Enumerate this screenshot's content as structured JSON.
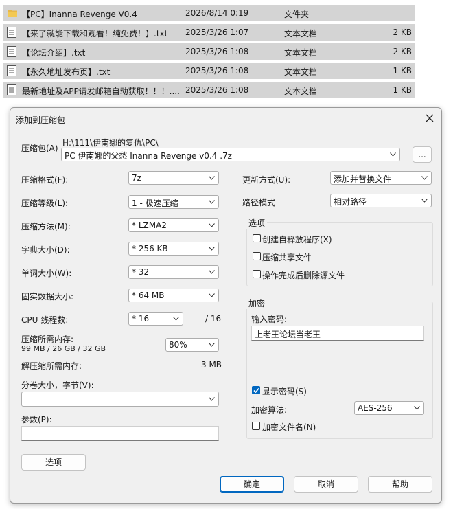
{
  "files": [
    {
      "icon": "folder-icon",
      "name": "【PC】Inanna Revenge V0.4",
      "date": "2026/8/14 0:19",
      "type": "文件夹",
      "size": ""
    },
    {
      "icon": "text-file-icon",
      "name": "【来了就能下载和观看！纯免费！】.txt",
      "date": "2025/3/26 1:07",
      "type": "文本文档",
      "size": "2 KB"
    },
    {
      "icon": "text-file-icon",
      "name": "【论坛介绍】.txt",
      "date": "2025/3/26 1:08",
      "type": "文本文档",
      "size": "2 KB"
    },
    {
      "icon": "text-file-icon",
      "name": "【永久地址发布页】.txt",
      "date": "2025/3/26 1:08",
      "type": "文本文档",
      "size": "1 KB"
    },
    {
      "icon": "text-file-icon",
      "name": "最新地址及APP请发邮箱自动获取！！！....",
      "date": "2025/3/26 1:08",
      "type": "文本文档",
      "size": "1 KB"
    }
  ],
  "dialog": {
    "title": "添加到压缩包",
    "archive_label": "压缩包(A)",
    "archive_path": "H:\\111\\伊南娜的复仇\\PC\\",
    "archive_name": "PC 伊南娜的父愁 Inanna Revenge v0.4 .7z",
    "browse_label": "...",
    "left": [
      {
        "label": "压缩格式(F):",
        "value": "7z"
      },
      {
        "label": "压缩等级(L):",
        "value": "1 - 极速压缩"
      },
      {
        "label": "压缩方法(M):",
        "value": "* LZMA2"
      },
      {
        "label": "字典大小(D):",
        "value": "* 256 KB"
      },
      {
        "label": "单词大小(W):",
        "value": "* 32"
      },
      {
        "label": "固实数据大小:",
        "value": "* 64 MB"
      }
    ],
    "cpu_label": "CPU 线程数:",
    "cpu_value": "* 16",
    "cpu_total": "/ 16",
    "mem_label": "压缩所需内存:",
    "mem_detail": "99 MB / 26 GB / 32 GB",
    "mem_percent": "80%",
    "decomp_label": "解压缩所需内存:",
    "decomp_value": "3 MB",
    "split_label": "分卷大小，字节(V):",
    "split_value": "",
    "params_label": "参数(P):",
    "params_value": "",
    "options_button": "选项",
    "update_label": "更新方式(U):",
    "update_value": "添加并替换文件",
    "path_label": "路径模式",
    "path_value": "相对路径",
    "options_group": "选项",
    "opt_sfx": "创建自释放程序(X)",
    "opt_shared": "压缩共享文件",
    "opt_delete": "操作完成后删除源文件",
    "enc_group": "加密",
    "enc_pwd_label": "输入密码:",
    "enc_pwd_value": "上老王论坛当老王",
    "show_pwd": "显示密码(S)",
    "enc_algo_label": "加密算法:",
    "enc_algo_value": "AES-256",
    "enc_names": "加密文件名(N)",
    "ok": "确定",
    "cancel": "取消",
    "help": "帮助"
  },
  "colors": {
    "accent": "#0067c0",
    "row_selected": "#d4d4d4",
    "dialog_bg": "#f0f0f0",
    "folder": "#e8b84a"
  }
}
